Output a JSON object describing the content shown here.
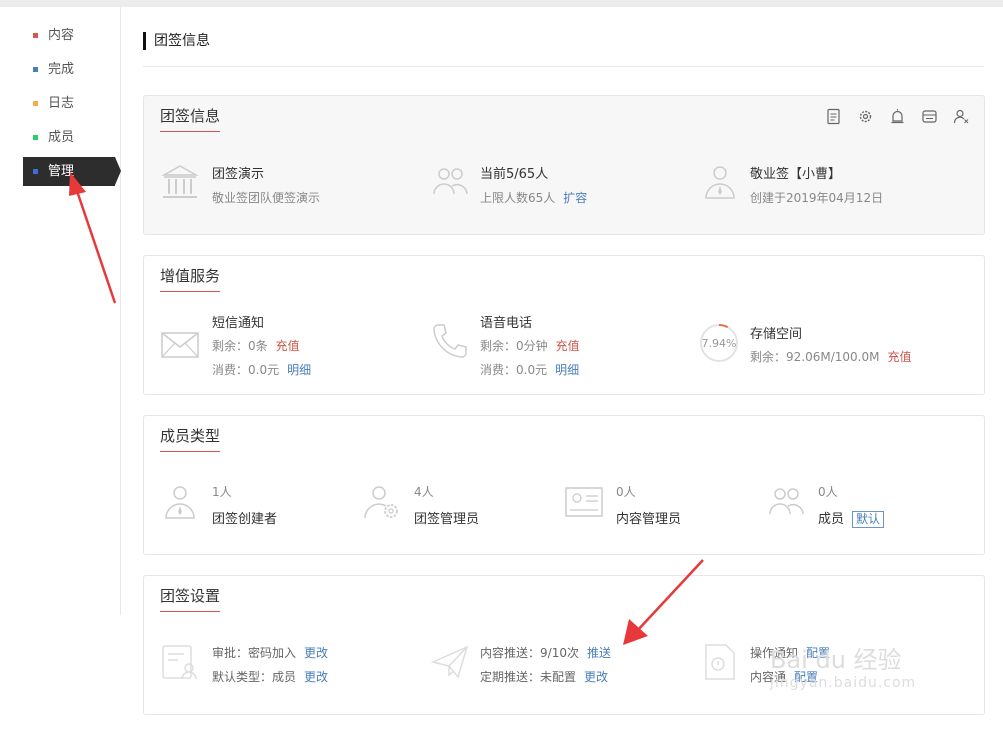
{
  "nav": [
    {
      "label": "内容",
      "color": "#d9534f"
    },
    {
      "label": "完成",
      "color": "#4a7ebb"
    },
    {
      "label": "日志",
      "color": "#f0ad4e"
    },
    {
      "label": "成员",
      "color": "#2ecc71"
    },
    {
      "label": "管理",
      "color": "#3a6fd8",
      "active": true
    }
  ],
  "page_title": "团签信息",
  "team_info": {
    "heading": "团签信息",
    "header_icons": [
      "document-icon",
      "settings-gear-icon",
      "alarm-icon",
      "card-icon",
      "member-remove-icon"
    ],
    "name": {
      "title": "团签演示",
      "desc": "敬业签团队便签演示"
    },
    "members": {
      "title": "当前5/65人",
      "desc": "上限人数65人",
      "action": "扩容"
    },
    "owner": {
      "title": "敬业签【小曹】",
      "desc": "创建于2019年04月12日"
    }
  },
  "value_service": {
    "heading": "增值服务",
    "sms": {
      "title": "短信通知",
      "remain_label": "剩余：",
      "remain": "0条",
      "recharge": "充值",
      "spent_label": "消费：",
      "spent": "0.0元",
      "detail": "明细"
    },
    "voice": {
      "title": "语音电话",
      "remain_label": "剩余：",
      "remain": "0分钟",
      "recharge": "充值",
      "spent_label": "消费：",
      "spent": "0.0元",
      "detail": "明细"
    },
    "storage": {
      "title": "存储空间",
      "percent": "7.94%",
      "percent_value": 7.94,
      "remain_label": "剩余：",
      "remain": "92.06M/100.0M",
      "recharge": "充值"
    }
  },
  "member_types": {
    "heading": "成员类型",
    "types": [
      {
        "count": "1人",
        "name": "团签创建者"
      },
      {
        "count": "4人",
        "name": "团签管理员"
      },
      {
        "count": "0人",
        "name": "内容管理员"
      },
      {
        "count": "0人",
        "name": "成员",
        "badge": "默认"
      }
    ]
  },
  "settings": {
    "heading": "团签设置",
    "approval": {
      "label": "审批：",
      "value": "密码加入",
      "action": "更改"
    },
    "default_type": {
      "label": "默认类型：",
      "value": "成员",
      "action": "更改"
    },
    "push": {
      "label": "内容推送：",
      "value": "9/10次",
      "action": "推送"
    },
    "scheduled": {
      "label": "定期推送：",
      "value": "未配置",
      "action": "更改"
    },
    "op_notify": {
      "label": "操作通知",
      "action": "配置"
    },
    "content_notify": {
      "label": "内容通",
      "action": "配置"
    }
  },
  "watermark": {
    "brand": "Bai du 经验",
    "url": "jingyan.baidu.com"
  }
}
